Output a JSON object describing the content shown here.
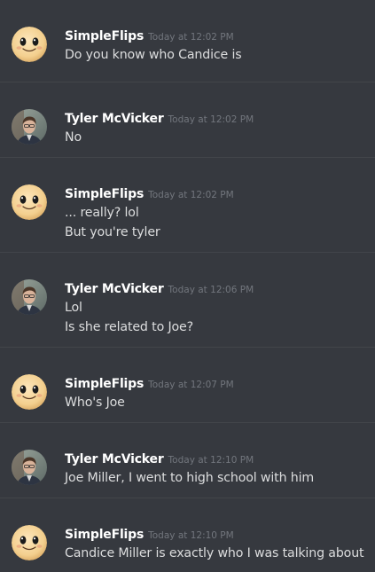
{
  "messages": [
    {
      "author": "SimpleFlips",
      "timestamp": "Today at 12:02 PM",
      "avatar_icon": "simpleflips-face-icon",
      "lines": [
        "Do you know who Candice is"
      ]
    },
    {
      "author": "Tyler McVicker",
      "timestamp": "Today at 12:02 PM",
      "avatar_icon": "tyler-photo-avatar",
      "lines": [
        "No"
      ]
    },
    {
      "author": "SimpleFlips",
      "timestamp": "Today at 12:02 PM",
      "avatar_icon": "simpleflips-face-icon",
      "lines": [
        "... really? lol",
        "But you're tyler"
      ]
    },
    {
      "author": "Tyler McVicker",
      "timestamp": "Today at 12:06 PM",
      "avatar_icon": "tyler-photo-avatar",
      "lines": [
        "Lol",
        "Is she related to Joe?"
      ]
    },
    {
      "author": "SimpleFlips",
      "timestamp": "Today at 12:07 PM",
      "avatar_icon": "simpleflips-face-icon",
      "lines": [
        "Who's Joe"
      ]
    },
    {
      "author": "Tyler McVicker",
      "timestamp": "Today at 12:10 PM",
      "avatar_icon": "tyler-photo-avatar",
      "lines": [
        "Joe Miller, I went to high school with him"
      ]
    },
    {
      "author": "SimpleFlips",
      "timestamp": "Today at 12:10 PM",
      "avatar_icon": "simpleflips-face-icon",
      "lines": [
        "Candice Miller is exactly who I was talking about"
      ]
    }
  ],
  "colors": {
    "background": "#36393f",
    "divider": "#42454a",
    "username": "#ffffff",
    "timestamp": "#72767d",
    "message_text": "#dcddde"
  }
}
